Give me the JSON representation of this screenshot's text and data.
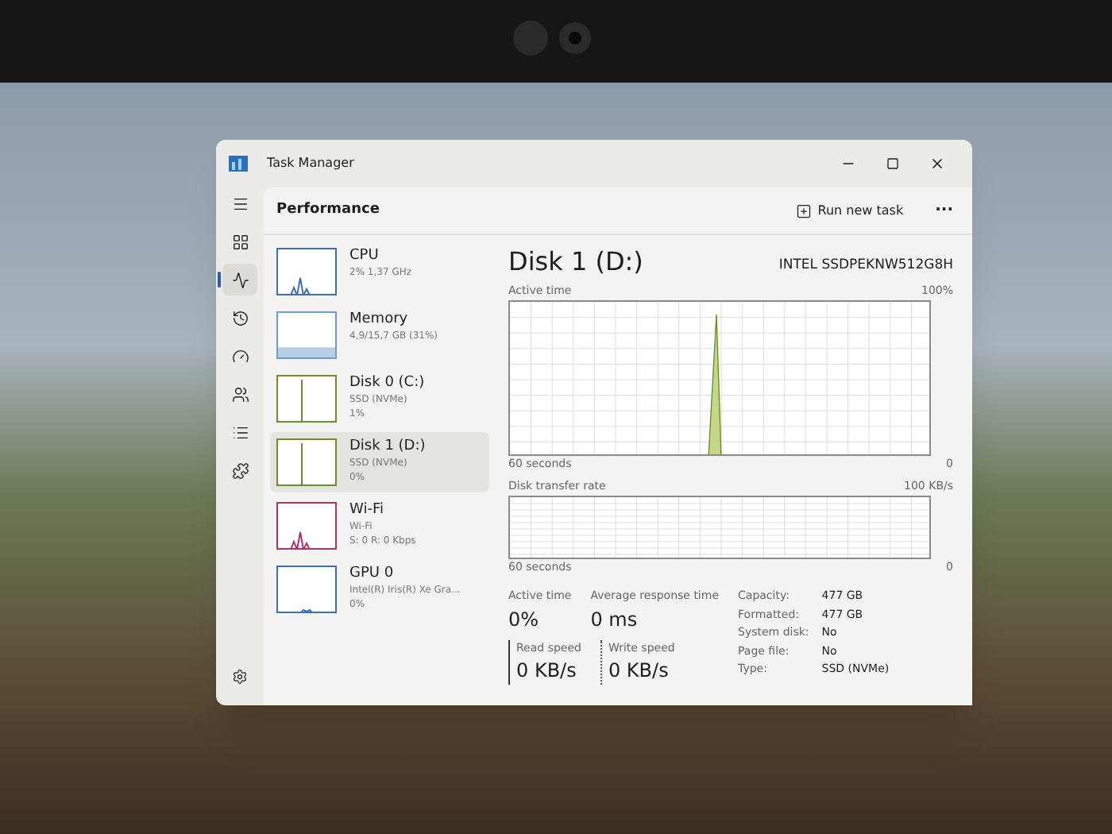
{
  "window": {
    "title": "Task Manager"
  },
  "nav": [
    {
      "selected": false
    },
    {
      "selected": false
    },
    {
      "selected": true
    },
    {
      "selected": false
    },
    {
      "selected": false
    },
    {
      "selected": false
    },
    {
      "selected": false
    },
    {
      "selected": false
    }
  ],
  "header": {
    "title": "Performance",
    "run_task": "Run new task",
    "more": "···"
  },
  "resources": [
    {
      "name": "CPU",
      "lines": [
        "2% 1,37 GHz"
      ],
      "kind": "spike",
      "color": "#3b6fb6",
      "selected": false
    },
    {
      "name": "Memory",
      "lines": [
        "4,9/15,7 GB (31%)"
      ],
      "kind": "fill",
      "level": 0.31,
      "color": "#6e9ccf",
      "selected": false
    },
    {
      "name": "Disk 0 (C:)",
      "lines": [
        "SSD (NVMe)",
        "1%"
      ],
      "kind": "line",
      "color": "#6b8f2a",
      "selected": false
    },
    {
      "name": "Disk 1 (D:)",
      "lines": [
        "SSD (NVMe)",
        "0%"
      ],
      "kind": "line",
      "color": "#6b8f2a",
      "selected": true
    },
    {
      "name": "Wi-Fi",
      "lines": [
        "Wi-Fi",
        "S: 0 R: 0 Kbps"
      ],
      "kind": "spike",
      "color": "#b0306a",
      "selected": false
    },
    {
      "name": "GPU 0",
      "lines": [
        "Intel(R) Iris(R) Xe Gra...",
        "0%"
      ],
      "kind": "low",
      "color": "#3b6fb6",
      "selected": false
    }
  ],
  "detail": {
    "title": "Disk 1 (D:)",
    "model": "INTEL SSDPEKNW512G8H",
    "graphs": [
      {
        "label": "Active time",
        "max": "100%",
        "span": "60 seconds",
        "min": "0",
        "kind": "spike"
      },
      {
        "label": "Disk transfer rate",
        "max": "100 KB/s",
        "span": "60 seconds",
        "min": "0",
        "kind": "flat"
      }
    ],
    "stats": [
      {
        "label": "Active time",
        "value": "0%"
      },
      {
        "label": "Average response time",
        "value": "0 ms"
      }
    ],
    "speeds": [
      {
        "label": "Read speed",
        "value": "0 KB/s",
        "kind": "solid"
      },
      {
        "label": "Write speed",
        "value": "0 KB/s",
        "kind": "dotted"
      }
    ],
    "properties": [
      {
        "label": "Capacity:",
        "value": "477 GB"
      },
      {
        "label": "Formatted:",
        "value": "477 GB"
      },
      {
        "label": "System disk:",
        "value": "No"
      },
      {
        "label": "Page file:",
        "value": "No"
      },
      {
        "label": "Type:",
        "value": "SSD (NVMe)"
      }
    ]
  }
}
